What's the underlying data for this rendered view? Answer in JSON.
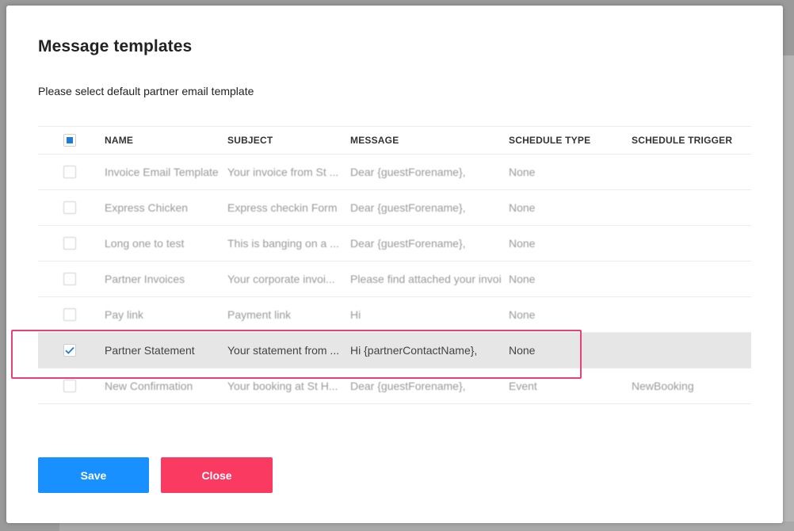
{
  "modal": {
    "title": "Message templates",
    "subtitle": "Please select default partner email template"
  },
  "table": {
    "headers": [
      "NAME",
      "SUBJECT",
      "MESSAGE",
      "SCHEDULE TYPE",
      "SCHEDULE TRIGGER"
    ],
    "rows": [
      {
        "name": "Invoice Email Template",
        "subject": "Your invoice from St ...",
        "message": "Dear {guestForename},",
        "schedule_type": "None",
        "schedule_trigger": "",
        "checked": false
      },
      {
        "name": "Express Chicken",
        "subject": "Express checkin Form",
        "message": "Dear {guestForename},",
        "schedule_type": "None",
        "schedule_trigger": "",
        "checked": false
      },
      {
        "name": "Long one to test",
        "subject": "This is banging on a ...",
        "message": "Dear {guestForename},",
        "schedule_type": "None",
        "schedule_trigger": "",
        "checked": false
      },
      {
        "name": "Partner Invoices",
        "subject": "Your corporate invoi...",
        "message": "Please find attached your invoi",
        "schedule_type": "None",
        "schedule_trigger": "",
        "checked": false
      },
      {
        "name": "Pay link",
        "subject": "Payment link",
        "message": "Hi",
        "schedule_type": "None",
        "schedule_trigger": "",
        "checked": false
      },
      {
        "name": "Partner Statement",
        "subject": "Your statement from ...",
        "message": "Hi {partnerContactName},",
        "schedule_type": "None",
        "schedule_trigger": "",
        "checked": true
      },
      {
        "name": "New Confirmation",
        "subject": "Your booking at St H...",
        "message": "Dear {guestForename},",
        "schedule_type": "Event",
        "schedule_trigger": "NewBooking",
        "checked": false
      }
    ]
  },
  "buttons": {
    "save_label": "Save",
    "close_label": "Close"
  },
  "colors": {
    "save": "#1890ff",
    "close": "#fb3a61",
    "highlight": "#e8407a",
    "checkbox_accent": "#1e7bd6"
  }
}
